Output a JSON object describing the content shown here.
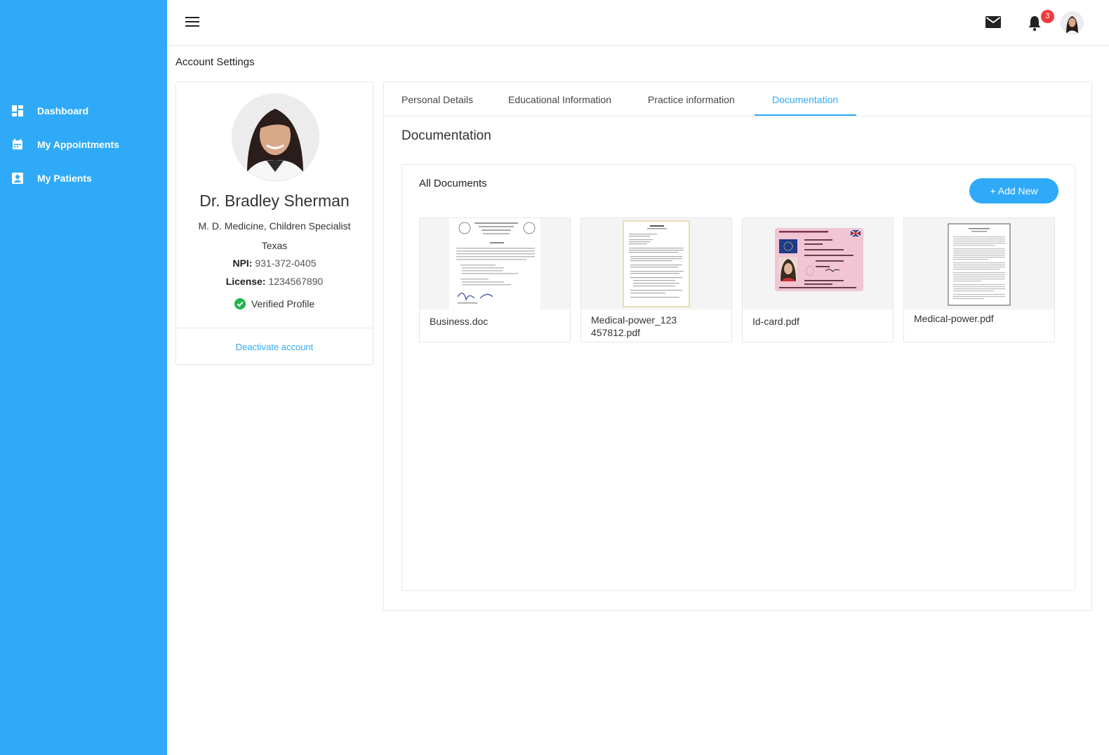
{
  "sidebar": {
    "items": [
      {
        "label": "Dashboard",
        "icon": "dashboard-icon"
      },
      {
        "label": "My Appointments",
        "icon": "calendar-icon"
      },
      {
        "label": "My Patients",
        "icon": "patient-icon"
      }
    ]
  },
  "header": {
    "notification_count": "3",
    "icons": [
      "menu-icon",
      "mail-icon",
      "bell-icon",
      "avatar"
    ]
  },
  "page_title": "Account Settings",
  "profile": {
    "name": "Dr. Bradley Sherman",
    "specialty": "M. D. Medicine, Children Specialist",
    "location": "Texas",
    "npi_label": "NPI:",
    "npi_value": "931-372-0405",
    "license_label": "License:",
    "license_value": "1234567890",
    "verified_label": "Verified Profile",
    "deactivate_label": "Deactivate account"
  },
  "tabs": [
    {
      "label": "Personal Details",
      "active": false
    },
    {
      "label": "Educational Information",
      "active": false
    },
    {
      "label": "Practice information",
      "active": false
    },
    {
      "label": "Documentation",
      "active": true
    }
  ],
  "documentation": {
    "title": "Documentation",
    "list_title": "All Documents",
    "add_button": "+ Add New",
    "documents": [
      {
        "name": "Business.doc",
        "thumb": "letter-document-thumbnail"
      },
      {
        "name": "Medical-power_123 457812.pdf",
        "thumb": "form-document-thumbnail"
      },
      {
        "name": "Id-card.pdf",
        "thumb": "id-card-thumbnail"
      },
      {
        "name": "Medical-power.pdf",
        "thumb": "text-document-thumbnail"
      }
    ]
  },
  "colors": {
    "accent": "#2eaaf8",
    "badge": "#f2393d",
    "verified": "#21b24b"
  }
}
